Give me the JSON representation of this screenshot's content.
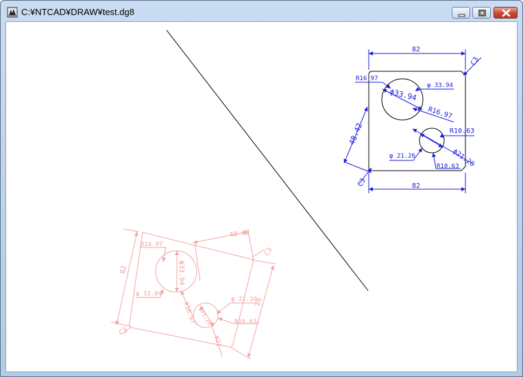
{
  "window": {
    "title": "C:¥NTCAD¥DRAW¥test.dg8"
  },
  "colors": {
    "dimension": "#1a1adc",
    "geometry": "#000000",
    "ghost": "#f2a0a0",
    "titlebar": "#c3d7ef"
  },
  "icons": [
    "app-icon",
    "minimize-icon",
    "maximize-icon",
    "close-icon"
  ],
  "drawing": {
    "dims": {
      "top_width": "82",
      "bottom_width": "82",
      "height": "48.42",
      "chamfer_top": "C3",
      "chamfer_bottom": "C3",
      "radius_large_left": "R16.97",
      "dia_large_inner": "ϕ33.94",
      "dia_large_right": "φ 33.94",
      "radius_large_lower": "R16.97",
      "radius_small_upper": "R10.63",
      "dia_small_left": "φ 21.26",
      "dia_small_diag": "ϕ21.26",
      "radius_small_bottom": "R10.63"
    },
    "ghost": {
      "r1697": "R16.97",
      "d3394_left": "φ 33.94",
      "d3394_inner": "ϕ33.94",
      "h4842": "48.42",
      "c3_top": "C3",
      "c3_bottom": "C3",
      "w82_left": "82",
      "w82_right": "82",
      "d2126": "φ 21.26",
      "r1063": "R10.63",
      "r1697_b": "R16.97",
      "d21_diag": "ϕ21.26",
      "small_mark": "φ21"
    }
  }
}
